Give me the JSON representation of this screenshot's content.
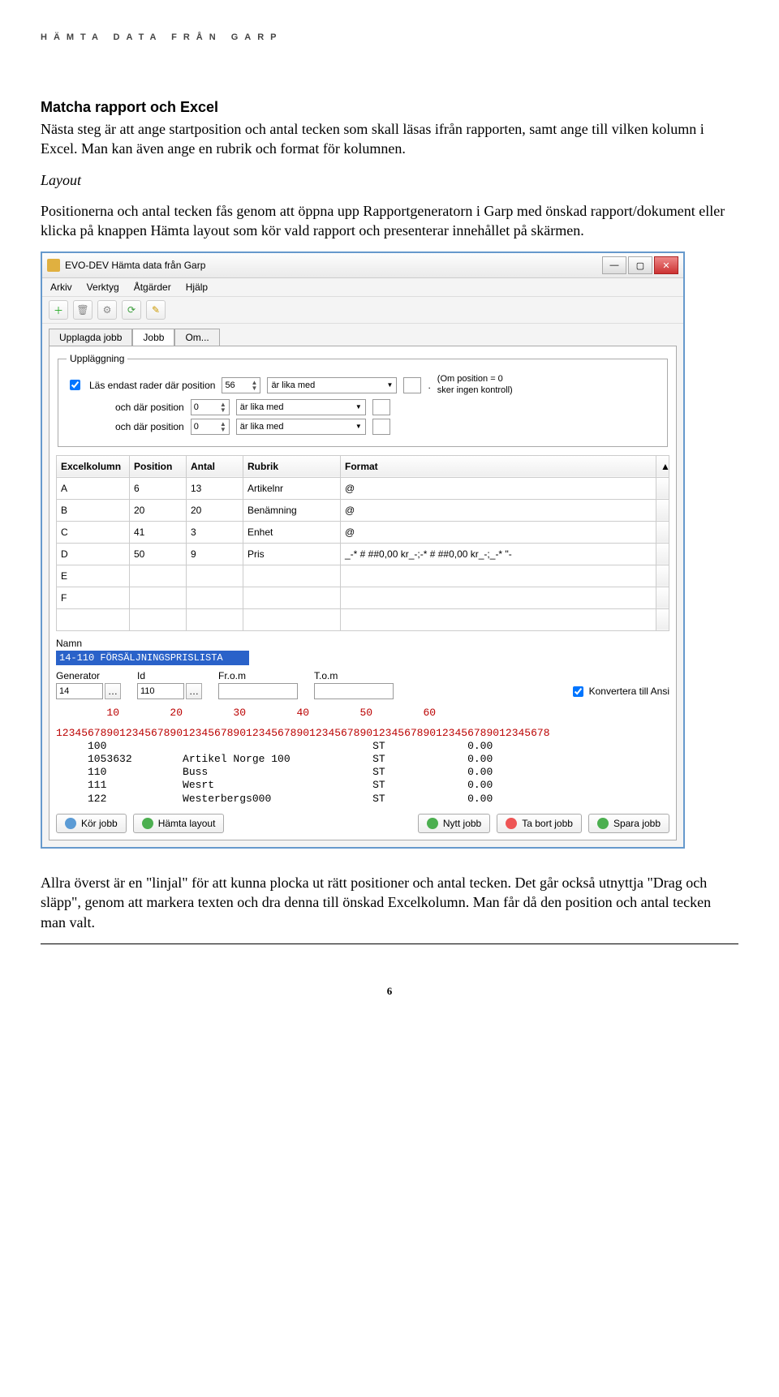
{
  "page_header": "HÄMTA DATA FRÅN GARP",
  "section1_title": "Matcha rapport och Excel",
  "section1_p1": "Nästa steg är att ange startposition och antal tecken som skall läsas ifrån rapporten, samt ange till vilken kolumn i Excel. Man kan även ange en rubrik och format för kolumnen.",
  "section2_title": "Layout",
  "section2_p1": "Positionerna och antal tecken fås genom att öppna upp Rapportgeneratorn i Garp med önskad rapport/dokument eller klicka på knappen Hämta layout som kör vald rapport och presenterar innehållet på skärmen.",
  "footer_p1": "Allra överst är en \"linjal\" för att kunna plocka ut rätt positioner och antal tecken. Det går också utnyttja \"Drag och släpp\", genom att markera texten och dra denna till önskad Excelkolumn. Man får då den position och antal tecken man valt.",
  "page_number": "6",
  "win": {
    "title": "EVO-DEV Hämta data från Garp",
    "menu": [
      "Arkiv",
      "Verktyg",
      "Åtgärder",
      "Hjälp"
    ],
    "tabs": [
      "Upplagda jobb",
      "Jobb",
      "Om..."
    ],
    "active_tab": 1,
    "fieldset_legend": "Uppläggning",
    "cb_label": "Läs endast rader där position",
    "pos_values": [
      "56",
      "0",
      "0"
    ],
    "combo_label": "är lika med",
    "and_label": "och där position",
    "dot": ".",
    "hint1": "(Om position = 0",
    "hint2": "sker ingen kontroll)",
    "grid_headers": [
      "Excelkolumn",
      "Position",
      "Antal",
      "Rubrik",
      "Format"
    ],
    "grid_rows": [
      {
        "c": "A",
        "p": "6",
        "a": "13",
        "r": "Artikelnr",
        "f": "@"
      },
      {
        "c": "B",
        "p": "20",
        "a": "20",
        "r": "Benämning",
        "f": "@"
      },
      {
        "c": "C",
        "p": "41",
        "a": "3",
        "r": "Enhet",
        "f": "@"
      },
      {
        "c": "D",
        "p": "50",
        "a": "9",
        "r": "Pris",
        "f": "_-* # ##0,00 kr_-;-* # ##0,00 kr_-;_-* \"-"
      },
      {
        "c": "E",
        "p": "",
        "a": "",
        "r": "",
        "f": ""
      },
      {
        "c": "F",
        "p": "",
        "a": "",
        "r": "",
        "f": ""
      },
      {
        "c": "",
        "p": "",
        "a": "",
        "r": "",
        "f": ""
      }
    ],
    "name_label": "Namn",
    "name_value": "14-110 FÖRSÄLJNINGSPRISLISTA",
    "gen_label": "Generator",
    "gen_value": "14",
    "id_label": "Id",
    "id_value": "110",
    "from_label": "Fr.o.m",
    "to_label": "T.o.m",
    "ansi_label": "Konvertera till Ansi",
    "ruler1": "        10        20        30        40        50        60",
    "ruler2": "123456789012345678901234567890123456789012345678901234567890123456789012345678",
    "datarows": [
      "     100                                          ST             0.00",
      "     1053632        Artikel Norge 100             ST             0.00",
      "     110            Buss                          ST             0.00",
      "     111            Wesrt                         ST             0.00",
      "     122            Westerbergs000                ST             0.00"
    ],
    "btns": {
      "run": "Kör jobb",
      "layout": "Hämta layout",
      "new": "Nytt jobb",
      "del": "Ta bort jobb",
      "save": "Spara jobb"
    }
  }
}
